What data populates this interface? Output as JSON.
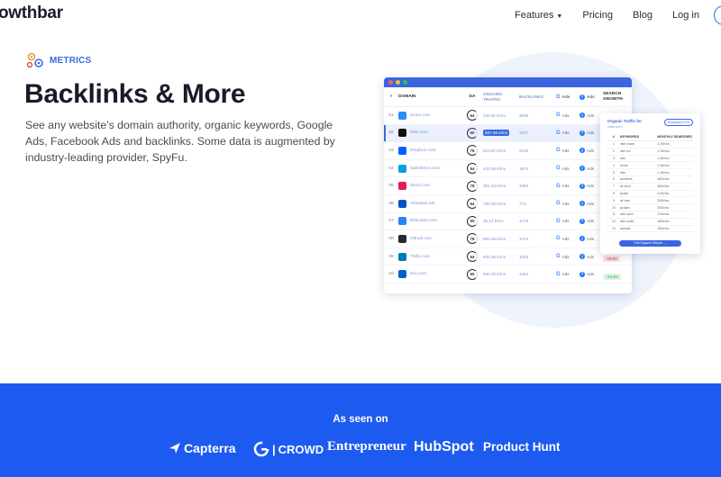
{
  "nav": {
    "logo": "owthbar",
    "links": [
      {
        "label": "Features",
        "has_dropdown": true
      },
      {
        "label": "Pricing"
      },
      {
        "label": "Blog"
      },
      {
        "label": "Log in"
      }
    ]
  },
  "hero": {
    "badge": "METRICS",
    "title": "Backlinks & More",
    "description": "See any website's domain authority, organic keywords, Google Ads, Facebook Ads and backlinks. Some data is augmented by industry-leading provider, SpyFu."
  },
  "table": {
    "headers": {
      "num": "#",
      "domain": "DOMAIN",
      "da": "DA",
      "traffic": "ORGANIC TRAFFIC",
      "backlinks": "BACKLINKS",
      "gads": "Ads",
      "fads": "Ads",
      "growth": "SEARCH GROWTH"
    },
    "ads_label": "Ads",
    "rows": [
      {
        "num": "01",
        "domain": "Zoom.com",
        "da": "64",
        "traffic": "134.5k k/mo",
        "backlinks": "3596",
        "growth": "",
        "icon_color": "#2d8cff",
        "highlight": false
      },
      {
        "num": "02",
        "domain": "Nike.com",
        "da": "50",
        "traffic": "937.66 k/mo",
        "backlinks": "3237",
        "growth": "",
        "icon_color": "#111111",
        "highlight": true
      },
      {
        "num": "03",
        "domain": "Dropbox.com",
        "da": "78",
        "traffic": "510.57 k/mo",
        "backlinks": "2216",
        "growth": "",
        "icon_color": "#0061ff",
        "highlight": false
      },
      {
        "num": "04",
        "domain": "Salesforce.com",
        "da": "64",
        "traffic": "443.08 k/mo",
        "backlinks": "1874",
        "growth": "",
        "icon_color": "#00a1e0",
        "highlight": false
      },
      {
        "num": "05",
        "domain": "Slack.com",
        "da": "78",
        "traffic": "301.43 k/mo",
        "backlinks": "4356",
        "growth": "",
        "icon_color": "#e01e5a",
        "highlight": false
      },
      {
        "num": "06",
        "domain": "Atlassian.net",
        "da": "64",
        "traffic": "780.00 k/mo",
        "backlinks": "773",
        "growth": "",
        "icon_color": "#0052cc",
        "highlight": false
      },
      {
        "num": "07",
        "domain": "Bitbucket.com",
        "da": "50",
        "traffic": "26.12 k/mo",
        "backlinks": "4476",
        "growth": "",
        "icon_color": "#2684ff",
        "highlight": false
      },
      {
        "num": "08",
        "domain": "Github.com",
        "da": "78",
        "traffic": "893.55 k/mo",
        "backlinks": "1474",
        "growth": "",
        "icon_color": "#24292e",
        "highlight": false
      },
      {
        "num": "09",
        "domain": "Trello.com",
        "da": "64",
        "traffic": "525.36 k/mo",
        "backlinks": "1093",
        "growth": "-48.6%",
        "growth_type": "neg",
        "icon_color": "#0079bf",
        "highlight": false
      },
      {
        "num": "10",
        "domain": "box.com",
        "da": "50",
        "traffic": "590.29 k/mo",
        "backlinks": "4464",
        "growth": "+14.5%",
        "growth_type": "pos",
        "icon_color": "#0061d5",
        "highlight": false
      }
    ]
  },
  "popup": {
    "title": "Organic Traffic for",
    "subtitle": "Nike.com",
    "button": "Download CSV",
    "headers": {
      "num": "#",
      "keywords": "KEYWORDS",
      "volume": "MONTHLY SEARCHES"
    },
    "rows": [
      {
        "num": "1",
        "keyword": "nike shoes",
        "volume": "2.2M/mo"
      },
      {
        "num": "2",
        "keyword": "nike run",
        "volume": "2.2M/mo"
      },
      {
        "num": "3",
        "keyword": "nike",
        "volume": "1.5M/mo"
      },
      {
        "num": "4",
        "keyword": "shoes",
        "volume": "1.4M/mo"
      },
      {
        "num": "5",
        "keyword": "nike",
        "volume": "1.1M/mo"
      },
      {
        "num": "6",
        "keyword": "sneakers",
        "volume": "680k/mo"
      },
      {
        "num": "7",
        "keyword": "air force",
        "volume": "550k/mo"
      },
      {
        "num": "8",
        "keyword": "jordan",
        "volume": "410k/mo"
      },
      {
        "num": "9",
        "keyword": "air max",
        "volume": "330k/mo"
      },
      {
        "num": "10",
        "keyword": "jordans",
        "volume": "250k/mo"
      },
      {
        "num": "11",
        "keyword": "nike store",
        "volume": "210k/mo"
      },
      {
        "num": "12",
        "keyword": "nike outlet",
        "volume": "180k/mo"
      },
      {
        "num": "13",
        "keyword": "sandals",
        "volume": "150k/mo"
      }
    ],
    "cta": "Full Organic Report →"
  },
  "press": {
    "heading": "As seen on",
    "logos": [
      "Capterra",
      "CROWD",
      "Entrepreneur",
      "HubSpot",
      "Product Hunt"
    ]
  },
  "colors": {
    "brand_blue": "#1d5bf0",
    "accent": "#3b66e0"
  }
}
